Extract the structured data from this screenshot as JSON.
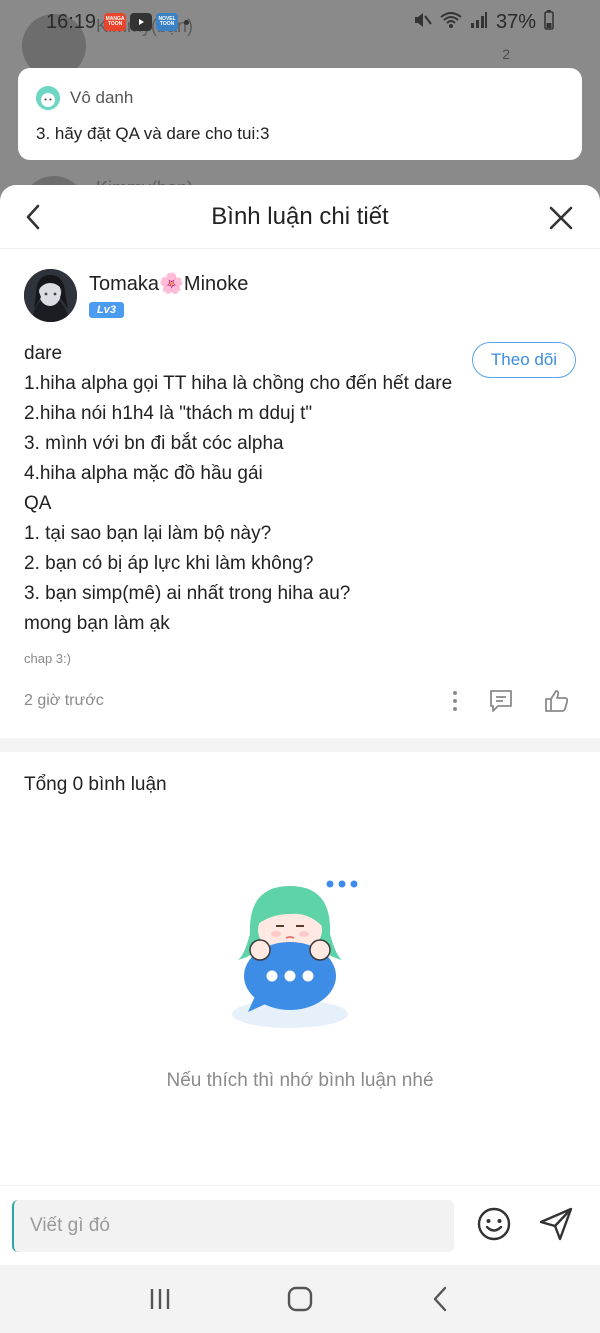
{
  "status_bar": {
    "time": "16:19",
    "battery": "37%",
    "apps": [
      "MANGA TOON",
      "YouTube",
      "NOVEL TOON"
    ]
  },
  "background_list": {
    "item1_name": "Kimmy(bạn)",
    "item1_count": "2",
    "item2_name": "Kimmy(bạn)"
  },
  "notification": {
    "sender": "Vô danh",
    "message": "3. hãy đặt QA và dare cho tui:3"
  },
  "sheet": {
    "title": "Bình luận chi tiết"
  },
  "comment": {
    "user_name": "Tomaka🌸Minoke",
    "level": "Lv3",
    "follow_label": "Theo dõi",
    "lines": [
      "dare",
      "1.hiha alpha gọi TT hiha là chồng cho đến hết dare",
      "2.hiha nói h1h4 là \"thách m dduj t\"",
      "3. mình với bn đi bắt cóc alpha",
      "4.hiha alpha mặc đồ hầu gái",
      "QA",
      "1. tại sao bạn lại làm bộ này?",
      "2. bạn có bị áp lực khi làm không?",
      "3. bạn simp(mê) ai nhất trong hiha au?",
      "mong bạn làm ạk"
    ],
    "reference": "chap 3:)",
    "time": "2 giờ trước"
  },
  "replies": {
    "total_label": "Tổng 0 bình luận",
    "empty_message": "Nếu thích thì nhớ bình luận nhé"
  },
  "input": {
    "placeholder": "Viết gì đó"
  },
  "colors": {
    "accent_blue": "#4b9cf0",
    "follow_border": "#5aa4e8",
    "mascot_hair": "#5fd3a8",
    "bubble_blue": "#3d8de6"
  }
}
